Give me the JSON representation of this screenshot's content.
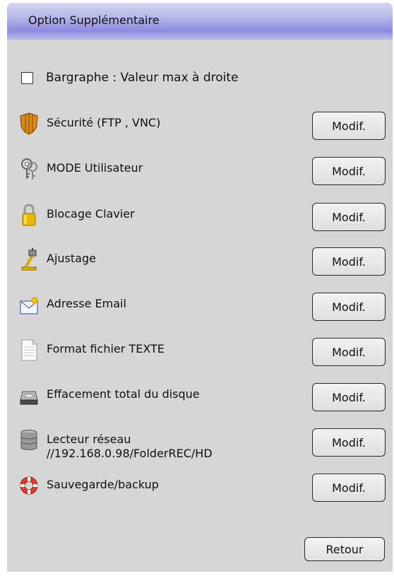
{
  "window": {
    "title": "Option Supplémentaire"
  },
  "bargraph_option": {
    "label": "Bargraphe : Valeur  max à droite",
    "checked": false
  },
  "settings": [
    {
      "label": "Sécurité (FTP , VNC)",
      "icon": "shield-icon",
      "button": "Modif."
    },
    {
      "label": "MODE Utilisateur",
      "icon": "keys-icon",
      "button": "Modif."
    },
    {
      "label": "Blocage Clavier",
      "icon": "padlock-icon",
      "button": "Modif."
    },
    {
      "label": "Ajustage",
      "icon": "caliper-icon",
      "button": "Modif."
    },
    {
      "label": "Adresse Email",
      "icon": "email-icon",
      "button": "Modif."
    },
    {
      "label": "Format fichier TEXTE",
      "icon": "text-file-icon",
      "button": "Modif."
    },
    {
      "label": "Effacement total du disque",
      "icon": "hard-disk-icon",
      "button": "Modif."
    },
    {
      "label": "Lecteur réseau\n//192.168.0.98/FolderREC/HD",
      "icon": "network-drive-icon",
      "button": "Modif."
    },
    {
      "label": "Sauvegarde/backup",
      "icon": "lifebuoy-icon",
      "button": "Modif."
    }
  ],
  "footer": {
    "back_label": "Retour"
  },
  "colors": {
    "panel": "#d6d6d6",
    "title_gradient_dark": "#8c8ce0",
    "title_gradient_light": "#d4d4f2"
  }
}
